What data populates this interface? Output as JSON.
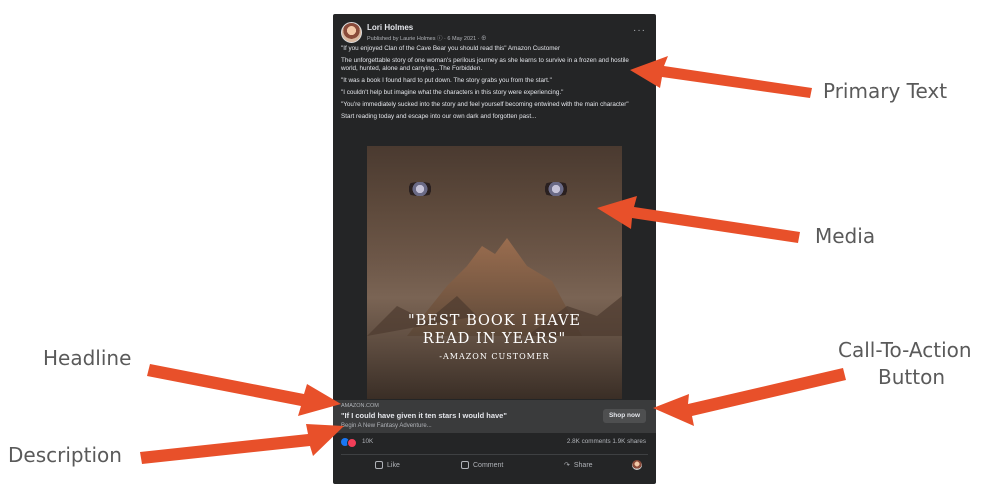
{
  "post": {
    "author": "Lori Holmes",
    "meta": "Published by Laurie Holmes ⓘ · 6 May 2021 · ",
    "primary_text": [
      "\"If you enjoyed Clan of the Cave Bear you should read this\" Amazon Customer",
      "The unforgettable story of one woman's perilous journey as she learns to survive in a frozen and hostile world, hunted, alone and carrying...The Forbidden.",
      "\"It was a book I found hard to put down. The story grabs you from the start.\"",
      " \"I couldn't help but imagine what the characters in this story were experiencing.\"",
      " \"You're immediately sucked into the story and feel yourself becoming entwined with the main character\"",
      "Start reading today and escape into our own dark and forgotten past..."
    ],
    "media": {
      "quote_line1": "\"BEST BOOK I HAVE",
      "quote_line2": "READ IN YEARS\"",
      "quote_attribution": "-AMAZON CUSTOMER"
    },
    "link": {
      "domain": "AMAZON.COM",
      "headline": "\"If I could have given it ten stars I would have\"",
      "description": "Begin A New Fantasy Adventure...",
      "cta": "Shop now"
    },
    "stats": {
      "reactions": "10K",
      "comments_shares": "2.8K comments  1.9K shares"
    },
    "actions": {
      "like": "Like",
      "comment": "Comment",
      "share": "Share"
    }
  },
  "annotations": {
    "primary_text": "Primary Text",
    "media": "Media",
    "headline": "Headline",
    "cta_line1": "Call-To-Action",
    "cta_line2": "Button",
    "description": "Description"
  },
  "colors": {
    "arrow": "#e8502a",
    "label": "#5a5a5a",
    "post_bg": "#242526"
  }
}
